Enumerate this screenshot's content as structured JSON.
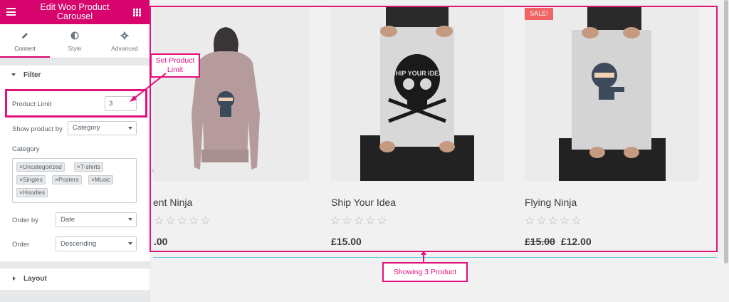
{
  "panel": {
    "title": "Edit Woo Product Carousel",
    "accent_color": "#d6046c",
    "tabs": [
      {
        "label": "Content",
        "icon": "pencil-icon",
        "active": true
      },
      {
        "label": "Style",
        "icon": "half-circle-icon",
        "active": false
      },
      {
        "label": "Advanced",
        "icon": "gear-icon",
        "active": false
      }
    ],
    "filter_section": {
      "title": "Filter",
      "product_limit_label": "Product Limit",
      "product_limit_value": "3",
      "show_product_by_label": "Show product by",
      "show_product_by_value": "Category",
      "category_label": "Category",
      "categories": [
        "Uncategorized",
        "T-shirts",
        "Singles",
        "Posters",
        "Music",
        "Hoodies"
      ],
      "tag_remove_glyph": "×",
      "order_by_label": "Order by",
      "order_by_value": "Date",
      "order_label": "Order",
      "order_value": "Descending"
    },
    "layout_section": {
      "title": "Layout"
    }
  },
  "annotations": {
    "set_limit_callout": "Set Product Limit",
    "showing_callout": "Showing 3 Product",
    "highlight_color": "#e2117c"
  },
  "preview": {
    "products": [
      {
        "name": "ent Ninja",
        "price": ".00",
        "old_price": "",
        "sale": false,
        "image": "hoodie"
      },
      {
        "name": "Ship Your Idea",
        "price": "£15.00",
        "old_price": "",
        "sale": false,
        "image": "poster-skull"
      },
      {
        "name": "Flying Ninja",
        "price": "£12.00",
        "old_price": "£15.00",
        "sale": true,
        "image": "poster-ninja"
      }
    ],
    "sale_badge": "SALE!",
    "stars_text": "☆☆☆☆☆",
    "poster_text": "SHIP YOUR IDEA"
  }
}
